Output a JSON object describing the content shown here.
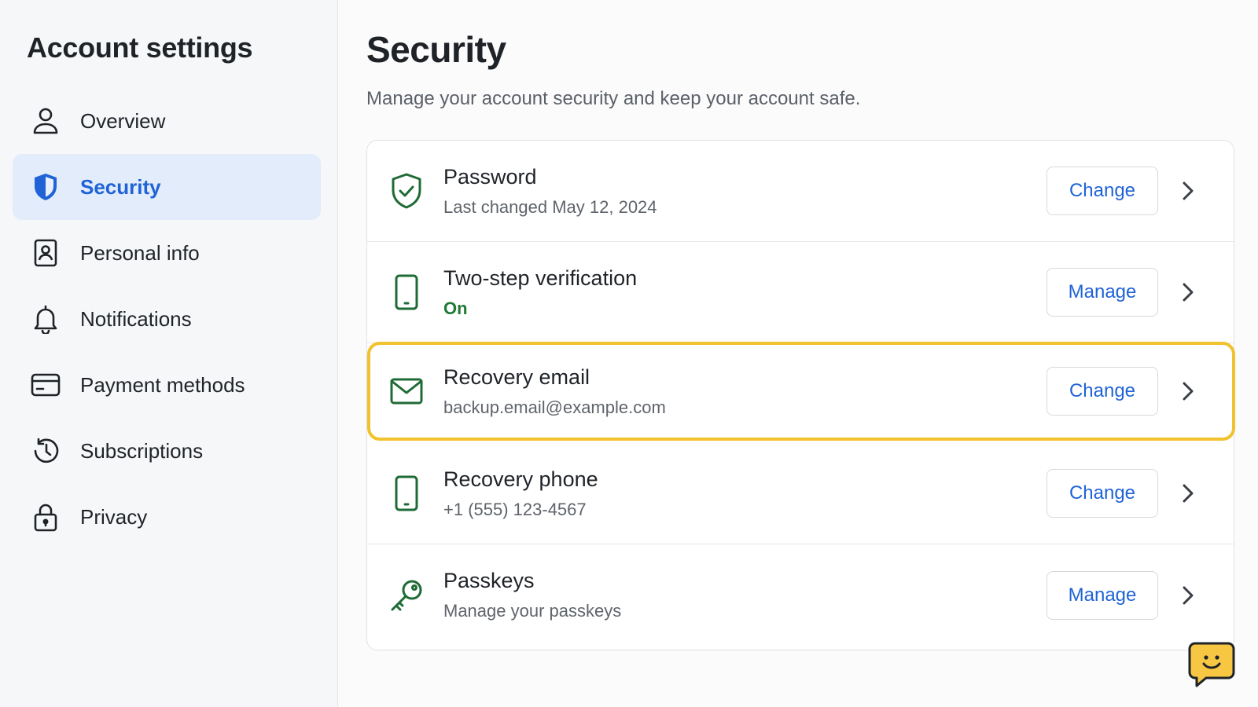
{
  "sidebar": {
    "title": "Account settings",
    "items": [
      {
        "label": "Overview",
        "icon": "person-icon"
      },
      {
        "label": "Security",
        "icon": "shield-icon",
        "active": true
      },
      {
        "label": "Personal info",
        "icon": "id-badge-icon"
      },
      {
        "label": "Notifications",
        "icon": "bell-icon"
      },
      {
        "label": "Payment methods",
        "icon": "credit-card-icon"
      },
      {
        "label": "Subscriptions",
        "icon": "history-icon"
      },
      {
        "label": "Privacy",
        "icon": "lock-icon"
      }
    ]
  },
  "main": {
    "title": "Security",
    "subtitle": "Manage your account security and keep your account safe.",
    "rows": [
      {
        "title": "Password",
        "sub": "Last changed May 12, 2024",
        "button": "Change",
        "icon": "shield-check-icon"
      },
      {
        "title": "Two-step verification",
        "sub": "On",
        "button": "Manage",
        "icon": "phone-icon"
      },
      {
        "title": "Recovery email",
        "sub": "backup.email@example.com",
        "button": "Change",
        "icon": "mail-icon",
        "highlighted": true
      },
      {
        "title": "Recovery phone",
        "sub": "+1 (555) 123-4567",
        "button": "Change",
        "icon": "phone-icon"
      },
      {
        "title": "Passkeys",
        "sub": "Manage your passkeys",
        "button": "Manage",
        "icon": "key-icon"
      }
    ]
  },
  "colors": {
    "accent": "#1f63d6",
    "active_bg": "#e3ecfa",
    "icon_green": "#1f6b35",
    "status_on": "#1f7a34",
    "highlight": "#f2c12e",
    "chat_fab": "#f7c744"
  },
  "chat": {
    "icon": "chat-smile-icon"
  }
}
